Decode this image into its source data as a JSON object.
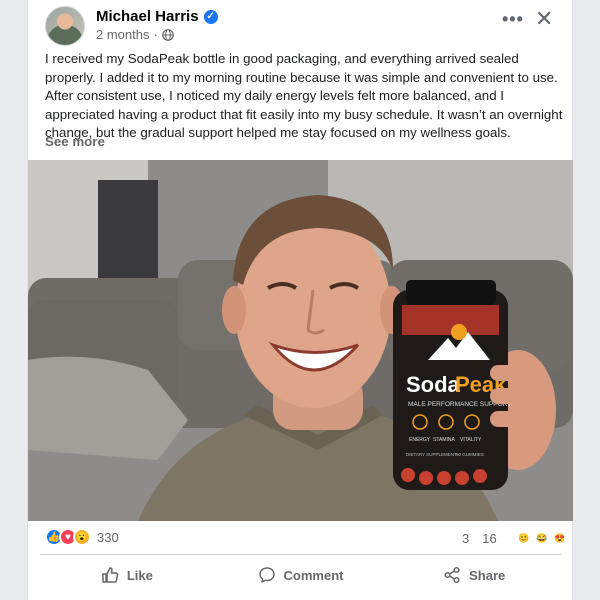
{
  "post": {
    "author": "Michael Harris",
    "timestamp": "2 months",
    "separator": "·",
    "text": "I received my SodaPeak bottle in good packaging, and everything arrived sealed properly. I added it to my morning routine because it was simple and convenient to use. After consistent use, I noticed my daily energy levels felt more balanced, and I appreciated having a product that fit easily into my busy schedule. It wasn’t an overnight change, but the gradual support helped me stay focused on my wellness goals.",
    "see_more": "See more"
  },
  "photo": {
    "product_brand_a": "Soda",
    "product_brand_b": "Peak",
    "product_tagline": "MALE PERFORMANCE SUPPORT",
    "product_benefits": [
      "ENERGY",
      "STAMINA",
      "VITALITY"
    ],
    "product_footer_left": "DIETARY SUPPLEMENT",
    "product_footer_right": "60 GUMMIES"
  },
  "stats": {
    "reaction_count": "330",
    "comment_count": "3",
    "share_count": "16",
    "reactions": [
      "like",
      "love",
      "wow"
    ]
  },
  "actions": {
    "like": "Like",
    "comment": "Comment",
    "share": "Share"
  },
  "colors": {
    "accent": "#1877f2",
    "brand_orange": "#f0a020"
  }
}
